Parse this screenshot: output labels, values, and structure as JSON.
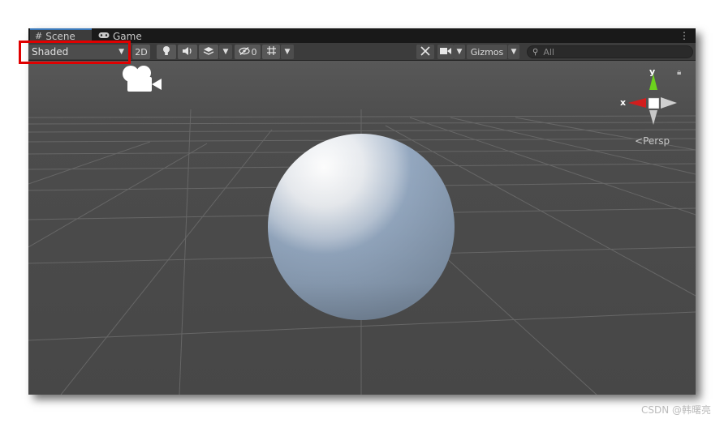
{
  "tabs": [
    {
      "label": "Scene",
      "icon": "hash-icon",
      "active": true
    },
    {
      "label": "Game",
      "icon": "gamepad-icon",
      "active": false
    }
  ],
  "toolbar": {
    "draw_mode": "Shaded",
    "btn_2d": "2D",
    "hidden_count": "0",
    "gizmos": "Gizmos",
    "search_placeholder": "All"
  },
  "gizmo": {
    "y_label": "y",
    "x_label": "x",
    "projection": "Persp",
    "colors": {
      "x": "#d11d1d",
      "y": "#6cd11d",
      "center": "#ffffff"
    }
  },
  "colors": {
    "highlight": "#e00000",
    "tab_accent": "#3a79bb",
    "scene_bg": "#4a4a4a"
  },
  "watermark": "CSDN @韩曙亮"
}
